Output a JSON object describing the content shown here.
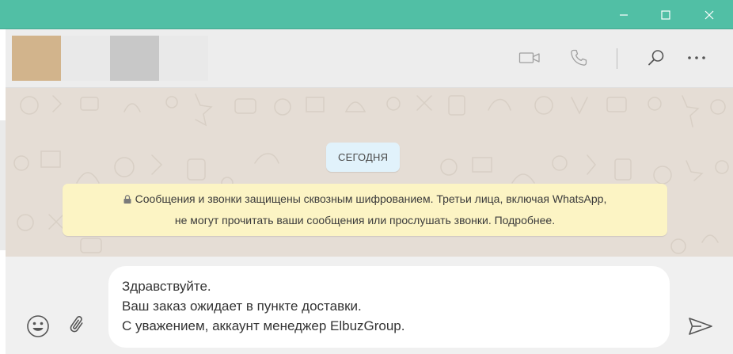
{
  "window": {
    "titlebar_color": "#51bfa5",
    "buttons": [
      "minimize-icon",
      "maximize-icon",
      "close-icon"
    ]
  },
  "header": {
    "avatars": [
      "#d2b48c",
      "#e9e9e9",
      "#c8c8c8",
      "#e9e9e9"
    ],
    "icons": [
      "video-call-icon",
      "voice-call-icon",
      "search-icon",
      "more-options-icon"
    ]
  },
  "chat": {
    "background": "#e5ddd5",
    "date_label": "СЕГОДНЯ",
    "encryption_notice": {
      "line1": "Сообщения и звонки защищены сквозным шифрованием. Третьи лица, включая WhatsApp,",
      "line2": "не могут прочитать ваши сообщения или прослушать звонки. Подробнее."
    }
  },
  "composer": {
    "lines": [
      "Здравствуйте.",
      "Ваш заказ ожидает в пункте доставки.",
      "С уважением, аккаунт менеджер ElbuzGroup."
    ],
    "icons": [
      "emoji-icon",
      "attach-icon",
      "send-icon"
    ]
  }
}
